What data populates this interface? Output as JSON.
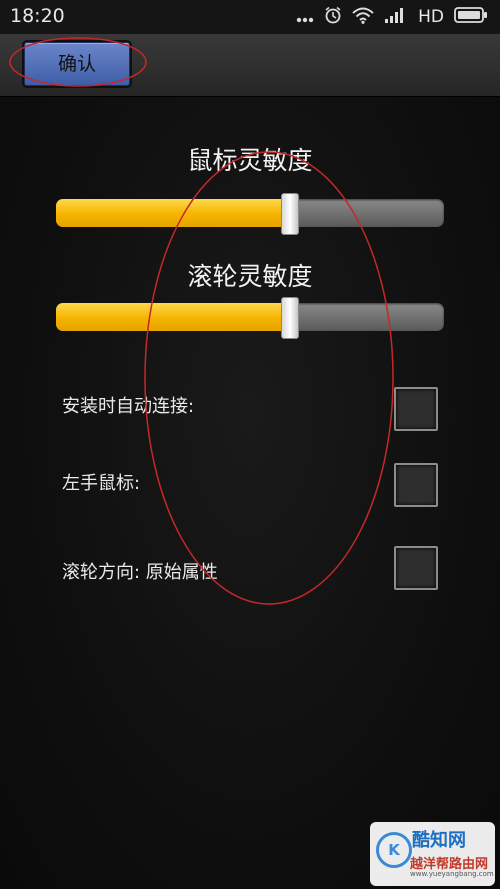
{
  "status_bar": {
    "time": "18:20",
    "network": "HD"
  },
  "action_bar": {
    "confirm_label": "确认"
  },
  "sliders": [
    {
      "title": "鼠标灵敏度",
      "value_percent": 60
    },
    {
      "title": "滚轮灵敏度",
      "value_percent": 60
    }
  ],
  "options": [
    {
      "label": "安装时自动连接:",
      "checked": false
    },
    {
      "label": "左手鼠标:",
      "checked": false
    },
    {
      "label": "滚轮方向: 原始属性",
      "checked": false
    }
  ],
  "colors": {
    "slider_fill": "#f4b400",
    "annotation": "#c62828",
    "button": "#4a68b4"
  },
  "watermark": {
    "name": "酷知网",
    "site": "越洋帮路由网",
    "url": "www.yueyangbang.com"
  }
}
